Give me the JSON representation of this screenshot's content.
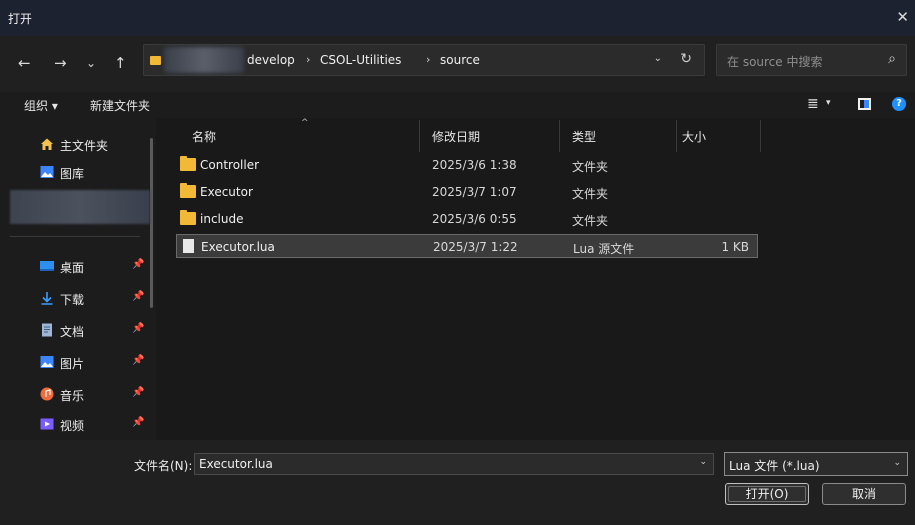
{
  "window": {
    "title": "打开",
    "close_glyph": "✕"
  },
  "nav": {
    "back": "←",
    "forward": "→",
    "recent": "⌄",
    "up": "↑"
  },
  "address": {
    "crumbs": [
      "develop",
      "CSOL-Utilities",
      "source"
    ],
    "separator": "›",
    "dropdown_glyph": "⌄",
    "refresh_glyph": "↻"
  },
  "search": {
    "placeholder": "在 source 中搜索",
    "icon": "search-icon",
    "glyph": "⌕"
  },
  "toolbar": {
    "organize_label": "组织 ▾",
    "new_folder_label": "新建文件夹",
    "view_glyph": "≣",
    "view_caret": "▾",
    "help_glyph": "?"
  },
  "sidebar": {
    "pin_glyph": "📌",
    "items": [
      {
        "label": "主文件夹",
        "icon": "home-icon",
        "pinned": false
      },
      {
        "label": "图库",
        "icon": "gallery-icon",
        "pinned": false
      },
      {
        "label": "桌面",
        "icon": "desktop-icon",
        "pinned": true
      },
      {
        "label": "下载",
        "icon": "download-icon",
        "pinned": true
      },
      {
        "label": "文档",
        "icon": "documents-icon",
        "pinned": true
      },
      {
        "label": "图片",
        "icon": "pictures-icon",
        "pinned": true
      },
      {
        "label": "音乐",
        "icon": "music-icon",
        "pinned": true
      },
      {
        "label": "视频",
        "icon": "videos-icon",
        "pinned": true
      }
    ]
  },
  "columns": {
    "name": "名称",
    "date": "修改日期",
    "type": "类型",
    "size": "大小",
    "sort_glyph": "^"
  },
  "files": [
    {
      "name": "Controller",
      "date": "2025/3/6 1:38",
      "type": "文件夹",
      "size": "",
      "kind": "folder"
    },
    {
      "name": "Executor",
      "date": "2025/3/7 1:07",
      "type": "文件夹",
      "size": "",
      "kind": "folder"
    },
    {
      "name": "include",
      "date": "2025/3/6 0:55",
      "type": "文件夹",
      "size": "",
      "kind": "folder"
    },
    {
      "name": "Executor.lua",
      "date": "2025/3/7 1:22",
      "type": "Lua 源文件",
      "size": "1 KB",
      "kind": "file",
      "selected": true
    }
  ],
  "footer": {
    "filename_label": "文件名(N):",
    "filename_value": "Executor.lua",
    "filetype_value": "Lua 文件 (*.lua)",
    "dropdown_glyph": "⌄",
    "open_label": "打开(O)",
    "cancel_label": "取消"
  },
  "colors": {
    "accent": "#1e90ff",
    "folder": "#f2b937",
    "titlebar": "#1d2231"
  }
}
